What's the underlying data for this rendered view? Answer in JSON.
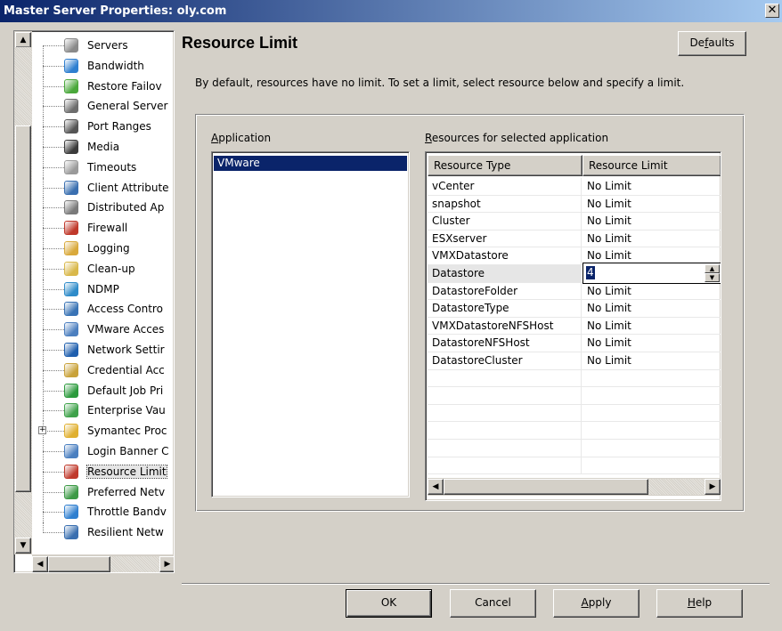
{
  "window": {
    "title": "Master Server Properties: oly.com",
    "close_glyph": "✕"
  },
  "tree": {
    "items": [
      {
        "label": "Servers",
        "icon": "server-icon",
        "color": "#8a8a8a"
      },
      {
        "label": "Bandwidth",
        "icon": "bandwidth-icon",
        "color": "#2f7fd0"
      },
      {
        "label": "Restore Failov",
        "icon": "restore-failover-icon",
        "color": "#4aa83b"
      },
      {
        "label": "General Server",
        "icon": "general-server-icon",
        "color": "#6d6d6d"
      },
      {
        "label": "Port Ranges",
        "icon": "port-ranges-icon",
        "color": "#555555"
      },
      {
        "label": "Media",
        "icon": "media-icon",
        "color": "#3b3b3b"
      },
      {
        "label": "Timeouts",
        "icon": "clock-icon",
        "color": "#9a9a9a"
      },
      {
        "label": "Client Attribute",
        "icon": "client-attributes-icon",
        "color": "#3a6fb0"
      },
      {
        "label": "Distributed Ap",
        "icon": "distributed-app-icon",
        "color": "#7a7a7a"
      },
      {
        "label": "Firewall",
        "icon": "firewall-icon",
        "color": "#c0392b"
      },
      {
        "label": "Logging",
        "icon": "logging-icon",
        "color": "#d9a93b"
      },
      {
        "label": "Clean-up",
        "icon": "clean-up-icon",
        "color": "#d9b84a"
      },
      {
        "label": "NDMP",
        "icon": "ndmp-icon",
        "color": "#2e8bc9"
      },
      {
        "label": "Access Contro",
        "icon": "access-control-icon",
        "color": "#3973b5"
      },
      {
        "label": "VMware Acces",
        "icon": "vmware-access-icon",
        "color": "#4c7fbf"
      },
      {
        "label": "Network Settir",
        "icon": "network-settings-icon",
        "color": "#1f5fae"
      },
      {
        "label": "Credential Acc",
        "icon": "credential-access-icon",
        "color": "#c9a23a"
      },
      {
        "label": "Default Job Pri",
        "icon": "job-priority-icon",
        "color": "#2b9a3c"
      },
      {
        "label": "Enterprise Vau",
        "icon": "enterprise-vault-icon",
        "color": "#3ea24a"
      },
      {
        "label": "Symantec Proc",
        "icon": "symantec-products-icon",
        "color": "#e0b030",
        "expander": "+"
      },
      {
        "label": "Login Banner C",
        "icon": "login-banner-icon",
        "color": "#4a7fc0"
      },
      {
        "label": "Resource Limit",
        "icon": "resource-limit-icon",
        "color": "#c0392b",
        "selected": true
      },
      {
        "label": "Preferred Netv",
        "icon": "preferred-network-icon",
        "color": "#3d9a46"
      },
      {
        "label": "Throttle Bandv",
        "icon": "throttle-bandwidth-icon",
        "color": "#2f7fd0"
      },
      {
        "label": "Resilient Netw",
        "icon": "resilient-network-icon",
        "color": "#3a6fb0"
      }
    ]
  },
  "main": {
    "title": "Resource Limit",
    "defaults_button": {
      "pre": "De",
      "mnemonic": "f",
      "post": "aults"
    },
    "description": "By default, resources have no limit. To set a limit, select resource below and specify a limit.",
    "application_label": {
      "mnemonic": "A",
      "post": "pplication"
    },
    "resources_label": {
      "mnemonic": "R",
      "post": "esources for selected application"
    },
    "applications": [
      "VMware"
    ],
    "columns": [
      "Resource Type",
      "Resource Limit"
    ],
    "rows": [
      {
        "type": "vCenter",
        "limit": "No Limit"
      },
      {
        "type": "snapshot",
        "limit": "No Limit"
      },
      {
        "type": "Cluster",
        "limit": "No Limit"
      },
      {
        "type": "ESXserver",
        "limit": "No Limit"
      },
      {
        "type": "VMXDatastore",
        "limit": "No Limit"
      },
      {
        "type": "Datastore",
        "limit": "4",
        "editing": true
      },
      {
        "type": "DatastoreFolder",
        "limit": "No Limit"
      },
      {
        "type": "DatastoreType",
        "limit": "No Limit"
      },
      {
        "type": "VMXDatastoreNFSHost",
        "limit": "No Limit"
      },
      {
        "type": "DatastoreNFSHost",
        "limit": "No Limit"
      },
      {
        "type": "DatastoreCluster",
        "limit": "No Limit"
      },
      {
        "type": "",
        "limit": ""
      },
      {
        "type": "",
        "limit": ""
      },
      {
        "type": "",
        "limit": ""
      },
      {
        "type": "",
        "limit": ""
      },
      {
        "type": "",
        "limit": ""
      },
      {
        "type": "",
        "limit": ""
      }
    ]
  },
  "footer": {
    "ok": "OK",
    "cancel": "Cancel",
    "apply": {
      "mnemonic": "A",
      "post": "pply"
    },
    "help": {
      "mnemonic": "H",
      "post": "elp"
    }
  }
}
